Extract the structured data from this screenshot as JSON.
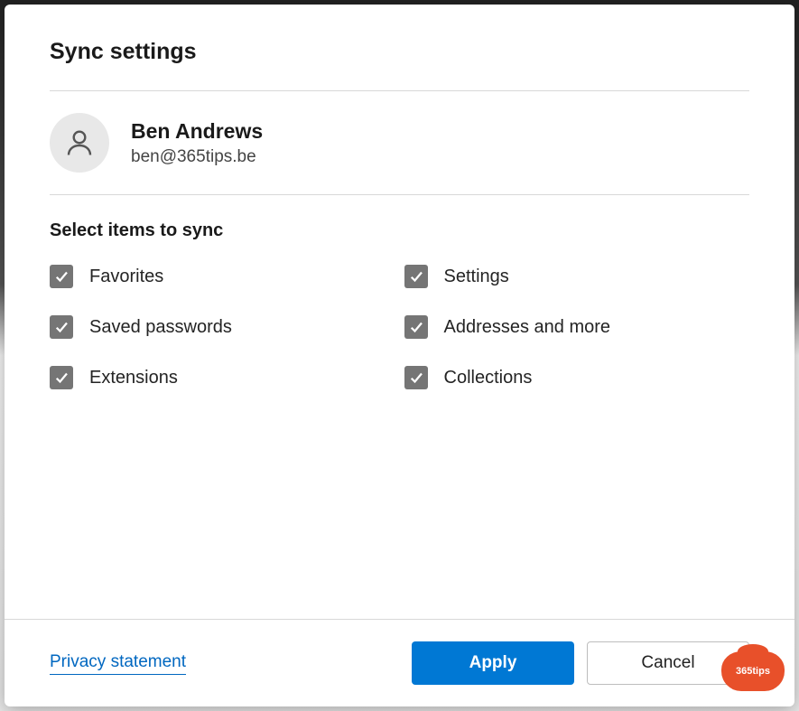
{
  "dialog": {
    "title": "Sync settings",
    "section_label": "Select items to sync"
  },
  "profile": {
    "name": "Ben Andrews",
    "email": "ben@365tips.be"
  },
  "sync_items": {
    "left": [
      {
        "label": "Favorites",
        "checked": true
      },
      {
        "label": "Saved passwords",
        "checked": true
      },
      {
        "label": "Extensions",
        "checked": true
      }
    ],
    "right": [
      {
        "label": "Settings",
        "checked": true
      },
      {
        "label": "Addresses and more",
        "checked": true
      },
      {
        "label": "Collections",
        "checked": true
      }
    ]
  },
  "footer": {
    "privacy_label": "Privacy statement",
    "apply_label": "Apply",
    "cancel_label": "Cancel"
  },
  "watermark": {
    "text": "365tips"
  }
}
